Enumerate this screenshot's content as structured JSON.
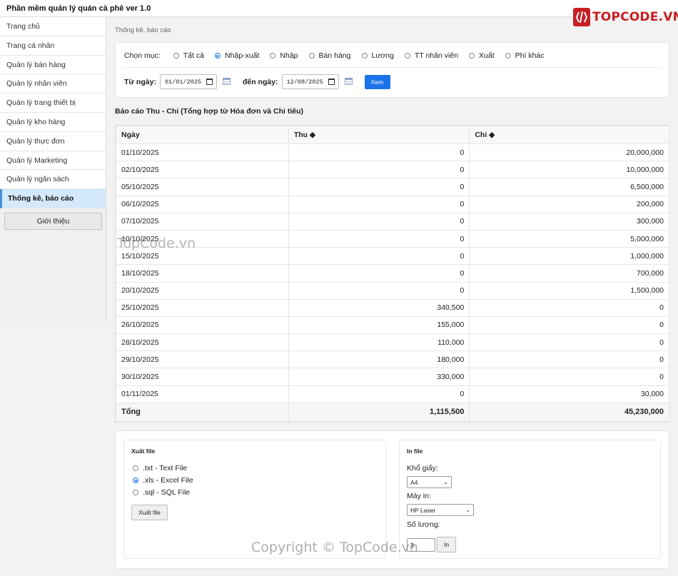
{
  "app": {
    "title": "Phần mềm quản lý quán cà phê ver 1.0"
  },
  "logo": {
    "text": "TOPCODE.VN"
  },
  "sidebar": {
    "items": [
      {
        "label": "Trang chủ"
      },
      {
        "label": "Trang cá nhân"
      },
      {
        "label": "Quản lý bán hàng"
      },
      {
        "label": "Quản lý nhân viên"
      },
      {
        "label": "Quản lý trang thiết bị"
      },
      {
        "label": "Quản lý kho hàng"
      },
      {
        "label": "Quản lý thực đơn"
      },
      {
        "label": "Quản lý Marketing"
      },
      {
        "label": "Quản lý ngân sách"
      },
      {
        "label": "Thống kê, báo cáo"
      }
    ],
    "about_label": "Giới thiệu"
  },
  "breadcrumb": "Thống kê, báo cáo",
  "filter": {
    "label": "Chọn mục:",
    "options": [
      "Tất cả",
      "Nhập-xuất",
      "Nhập",
      "Bán hàng",
      "Lương",
      "TT nhân viên",
      "Xuất",
      "Phí khác"
    ],
    "selected": "Nhập-xuất",
    "from_label": "Từ ngày:",
    "from_value": "01/01/2025",
    "to_label": "đến ngày:",
    "to_value": "12/08/2025",
    "view_label": "Xem"
  },
  "report": {
    "title": "Báo cáo Thu - Chi (Tổng hợp từ Hóa đơn và Chi tiêu)",
    "columns": [
      "Ngày",
      "Thu ◆",
      "Chi ◆"
    ],
    "rows": [
      [
        "01/10/2025",
        "0",
        "20,000,000"
      ],
      [
        "02/10/2025",
        "0",
        "10,000,000"
      ],
      [
        "05/10/2025",
        "0",
        "6,500,000"
      ],
      [
        "06/10/2025",
        "0",
        "200,000"
      ],
      [
        "07/10/2025",
        "0",
        "300,000"
      ],
      [
        "10/10/2025",
        "0",
        "5,000,000"
      ],
      [
        "15/10/2025",
        "0",
        "1,000,000"
      ],
      [
        "18/10/2025",
        "0",
        "700,000"
      ],
      [
        "20/10/2025",
        "0",
        "1,500,000"
      ],
      [
        "25/10/2025",
        "340,500",
        "0"
      ],
      [
        "26/10/2025",
        "155,000",
        "0"
      ],
      [
        "28/10/2025",
        "110,000",
        "0"
      ],
      [
        "29/10/2025",
        "180,000",
        "0"
      ],
      [
        "30/10/2025",
        "330,000",
        "0"
      ],
      [
        "01/11/2025",
        "0",
        "30,000"
      ]
    ],
    "total": [
      "Tổng",
      "1,115,500",
      "45,230,000"
    ]
  },
  "export": {
    "title": "Xuất file",
    "options": [
      ".txt - Text File",
      ".xls - Excel File",
      ".sql - SQL File"
    ],
    "selected": ".xls - Excel File",
    "button_label": "Xuất file"
  },
  "print": {
    "title": "In file",
    "paper_label": "Khổ giấy:",
    "paper_value": "A4",
    "printer_label": "Máy in:",
    "printer_value": "HP Laser",
    "qty_label": "Số lượng:",
    "qty_value": "3",
    "button_label": "In"
  },
  "watermarks": [
    "TopCode.vn",
    "Copyright © TopCode.vn"
  ]
}
